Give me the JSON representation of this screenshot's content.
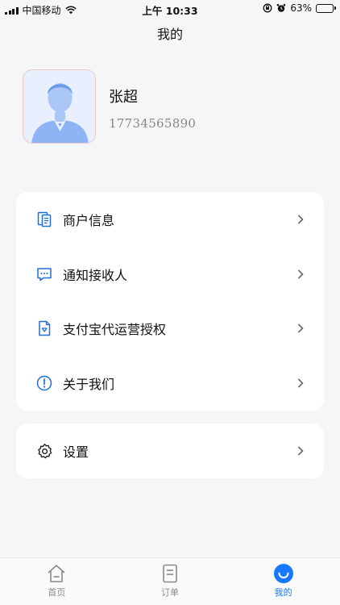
{
  "status_bar": {
    "carrier": "中国移动",
    "time": "上午 10:33",
    "battery_percent": "63%",
    "battery_level": 0.63
  },
  "nav": {
    "title": "我的"
  },
  "profile": {
    "name": "张超",
    "phone": "17734565890"
  },
  "menu": {
    "items": [
      {
        "label": "商户信息",
        "icon": "merchant-doc-icon"
      },
      {
        "label": "通知接收人",
        "icon": "chat-bubble-icon"
      },
      {
        "label": "支付宝代运营授权",
        "icon": "auth-doc-icon"
      },
      {
        "label": "关于我们",
        "icon": "info-circle-icon"
      }
    ]
  },
  "settings": {
    "label": "设置",
    "icon": "gear-icon"
  },
  "tabbar": {
    "tabs": [
      {
        "label": "首页",
        "icon": "home-icon"
      },
      {
        "label": "订单",
        "icon": "order-icon"
      },
      {
        "label": "我的",
        "icon": "profile-smile-icon"
      }
    ],
    "active_index": 2
  },
  "colors": {
    "accent": "#1677ff",
    "background": "#f5f6f8"
  }
}
